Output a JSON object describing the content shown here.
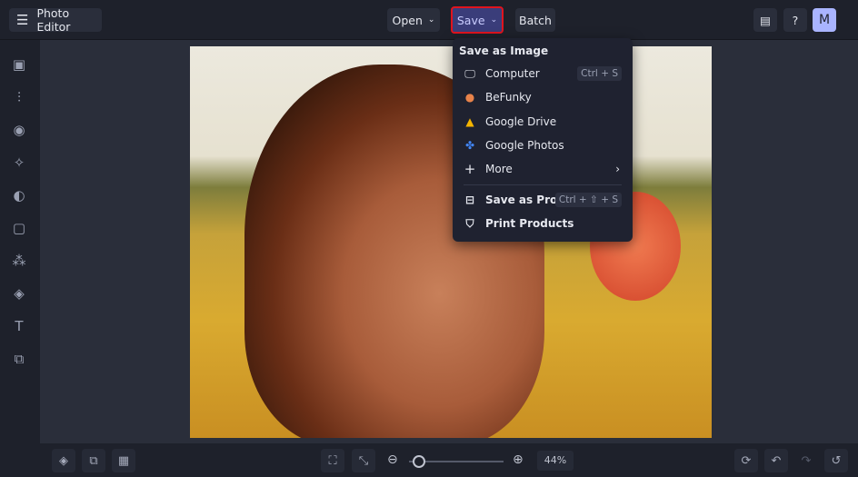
{
  "header": {
    "app_title": "Photo Editor",
    "open_label": "Open",
    "save_label": "Save",
    "batch_label": "Batch",
    "avatar_initial": "M"
  },
  "save_menu": {
    "section_title": "Save as Image",
    "items": [
      {
        "label": "Computer",
        "shortcut": "Ctrl + S",
        "icon": "monitor-icon"
      },
      {
        "label": "BeFunky",
        "icon": "befunky-icon"
      },
      {
        "label": "Google Drive",
        "icon": "google-drive-icon"
      },
      {
        "label": "Google Photos",
        "icon": "google-photos-icon"
      },
      {
        "label": "More",
        "icon": "plus-icon"
      }
    ],
    "project": {
      "label": "Save as Project",
      "shortcut": "Ctrl + ⇧ + S"
    },
    "print": {
      "label": "Print Products"
    }
  },
  "zoom": {
    "value": "44%",
    "level": 0.1
  },
  "colors": {
    "accent": "#3a3d7a",
    "highlight": "#e0141e",
    "avatar": "#a9b4ff"
  }
}
